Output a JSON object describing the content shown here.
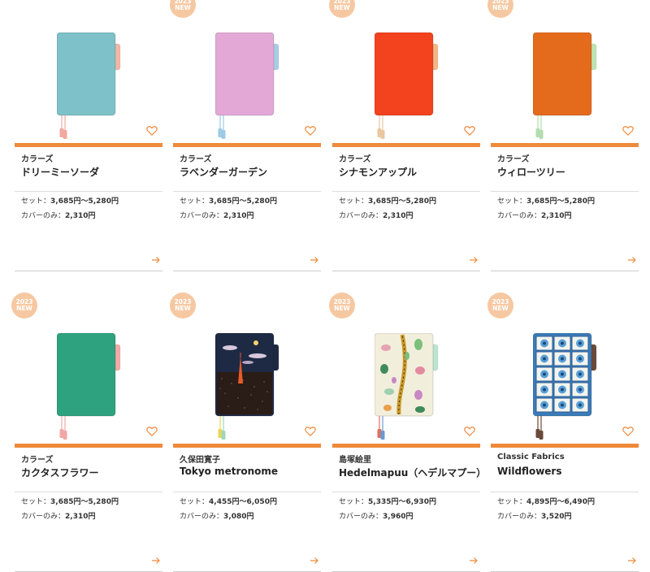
{
  "colors": {
    "accent": "#ef8a3c",
    "badge": "#f6c8a2"
  },
  "products": [
    {
      "series": "カラーズ",
      "name": "ドリーミーソーダ",
      "badge": null,
      "set_label": "セット：",
      "set_price": "3,685円〜5,280円",
      "cover_label": "カバーのみ：",
      "cover_price": "2,310円",
      "cover_color": "#7ec1c8",
      "tab_color": "#f0b8a6",
      "bookmark_colors": [
        "#f0a8a0",
        "#f0a8a0"
      ],
      "design": "plain"
    },
    {
      "series": "カラーズ",
      "name": "ラベンダーガーデン",
      "badge": [
        "2023",
        "NEW"
      ],
      "set_label": "セット：",
      "set_price": "3,685円〜5,280円",
      "cover_label": "カバーのみ：",
      "cover_price": "2,310円",
      "cover_color": "#e3a8d6",
      "tab_color": "#aacde6",
      "bookmark_colors": [
        "#9ecbe4",
        "#9ecbe4"
      ],
      "design": "plain"
    },
    {
      "series": "カラーズ",
      "name": "シナモンアップル",
      "badge": [
        "2023",
        "NEW"
      ],
      "set_label": "セット：",
      "set_price": "3,685円〜5,280円",
      "cover_label": "カバーのみ：",
      "cover_price": "2,310円",
      "cover_color": "#f3421e",
      "tab_color": "#f0b886",
      "bookmark_colors": [
        "#e9c7a0",
        "#e9c7a0"
      ],
      "design": "plain"
    },
    {
      "series": "カラーズ",
      "name": "ウィローツリー",
      "badge": [
        "2023",
        "NEW"
      ],
      "set_label": "セット：",
      "set_price": "3,685円〜5,280円",
      "cover_label": "カバーのみ：",
      "cover_price": "2,310円",
      "cover_color": "#e46a1c",
      "tab_color": "#bfe3b0",
      "bookmark_colors": [
        "#b3dcb0",
        "#b3dcb0"
      ],
      "design": "plain"
    },
    {
      "series": "カラーズ",
      "name": "カクタスフラワー",
      "badge": [
        "2023",
        "NEW"
      ],
      "set_label": "セット：",
      "set_price": "3,685円〜5,280円",
      "cover_label": "カバーのみ：",
      "cover_price": "2,310円",
      "cover_color": "#2ea27f",
      "tab_color": "#f2aaa6",
      "bookmark_colors": [
        "#f0a8a6",
        "#f0a8a6"
      ],
      "design": "plain"
    },
    {
      "series": "久保田寛子",
      "name": "Tokyo metronome",
      "badge": [
        "2023",
        "NEW"
      ],
      "set_label": "セット：",
      "set_price": "4,455円〜6,050円",
      "cover_label": "カバーのみ：",
      "cover_price": "3,080円",
      "cover_color": "#1e2a44",
      "tab_color": "#1e2a44",
      "bookmark_colors": [
        "#e8d45a",
        "#9fd7b8"
      ],
      "design": "tokyo"
    },
    {
      "series": "島塚絵里",
      "name": "Hedelmapuu（ヘデルマプー）",
      "badge": [
        "2023",
        "NEW"
      ],
      "set_label": "セット：",
      "set_price": "5,335円〜6,930円",
      "cover_label": "カバーのみ：",
      "cover_price": "3,960円",
      "cover_color": "#f2eedc",
      "tab_color": "#b9e6cf",
      "bookmark_colors": [
        "#e07060",
        "#6a9bd0"
      ],
      "design": "hedelma"
    },
    {
      "series": "Classic Fabrics",
      "name": "Wildflowers",
      "badge": [
        "2023",
        "NEW"
      ],
      "set_label": "セット：",
      "set_price": "4,895円〜6,490円",
      "cover_label": "カバーのみ：",
      "cover_price": "3,520円",
      "cover_color": "#3b7bb8",
      "tab_color": "#6a4a3a",
      "bookmark_colors": [
        "#6a4a3a",
        "#6a4a3a"
      ],
      "design": "wild"
    }
  ]
}
